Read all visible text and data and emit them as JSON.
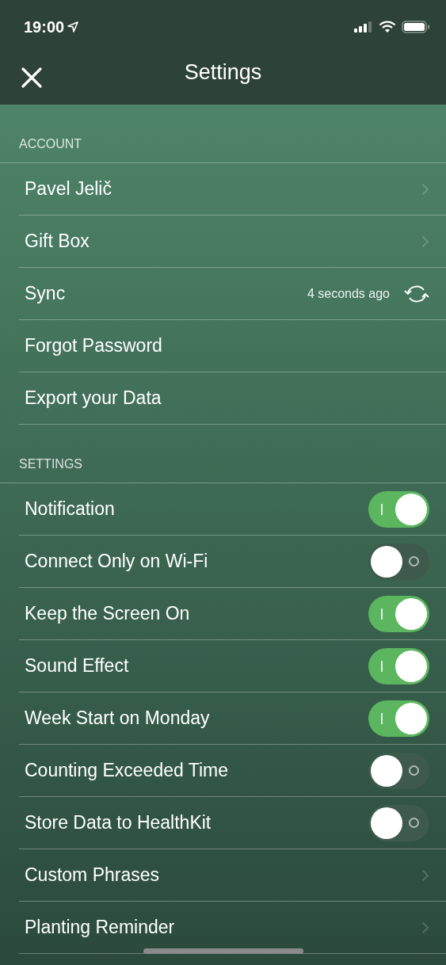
{
  "status_bar": {
    "time": "19:00"
  },
  "nav": {
    "title": "Settings"
  },
  "sections": [
    {
      "title": "ACCOUNT",
      "rows": [
        {
          "kind": "link",
          "label": "Pavel Jelič"
        },
        {
          "kind": "link",
          "label": "Gift Box"
        },
        {
          "kind": "sync",
          "label": "Sync",
          "value": "4 seconds ago"
        },
        {
          "kind": "plain",
          "label": "Forgot Password"
        },
        {
          "kind": "plain",
          "label": "Export your Data"
        }
      ]
    },
    {
      "title": "SETTINGS",
      "rows": [
        {
          "kind": "toggle",
          "label": "Notification",
          "on": true
        },
        {
          "kind": "toggle",
          "label": "Connect Only on Wi-Fi",
          "on": false
        },
        {
          "kind": "toggle",
          "label": "Keep the Screen On",
          "on": true
        },
        {
          "kind": "toggle",
          "label": "Sound Effect",
          "on": true
        },
        {
          "kind": "toggle",
          "label": "Week Start on Monday",
          "on": true
        },
        {
          "kind": "toggle",
          "label": "Counting Exceeded Time",
          "on": false
        },
        {
          "kind": "toggle",
          "label": "Store Data to HealthKit",
          "on": false
        },
        {
          "kind": "link",
          "label": "Custom Phrases"
        },
        {
          "kind": "link",
          "label": "Planting Reminder"
        }
      ]
    }
  ]
}
